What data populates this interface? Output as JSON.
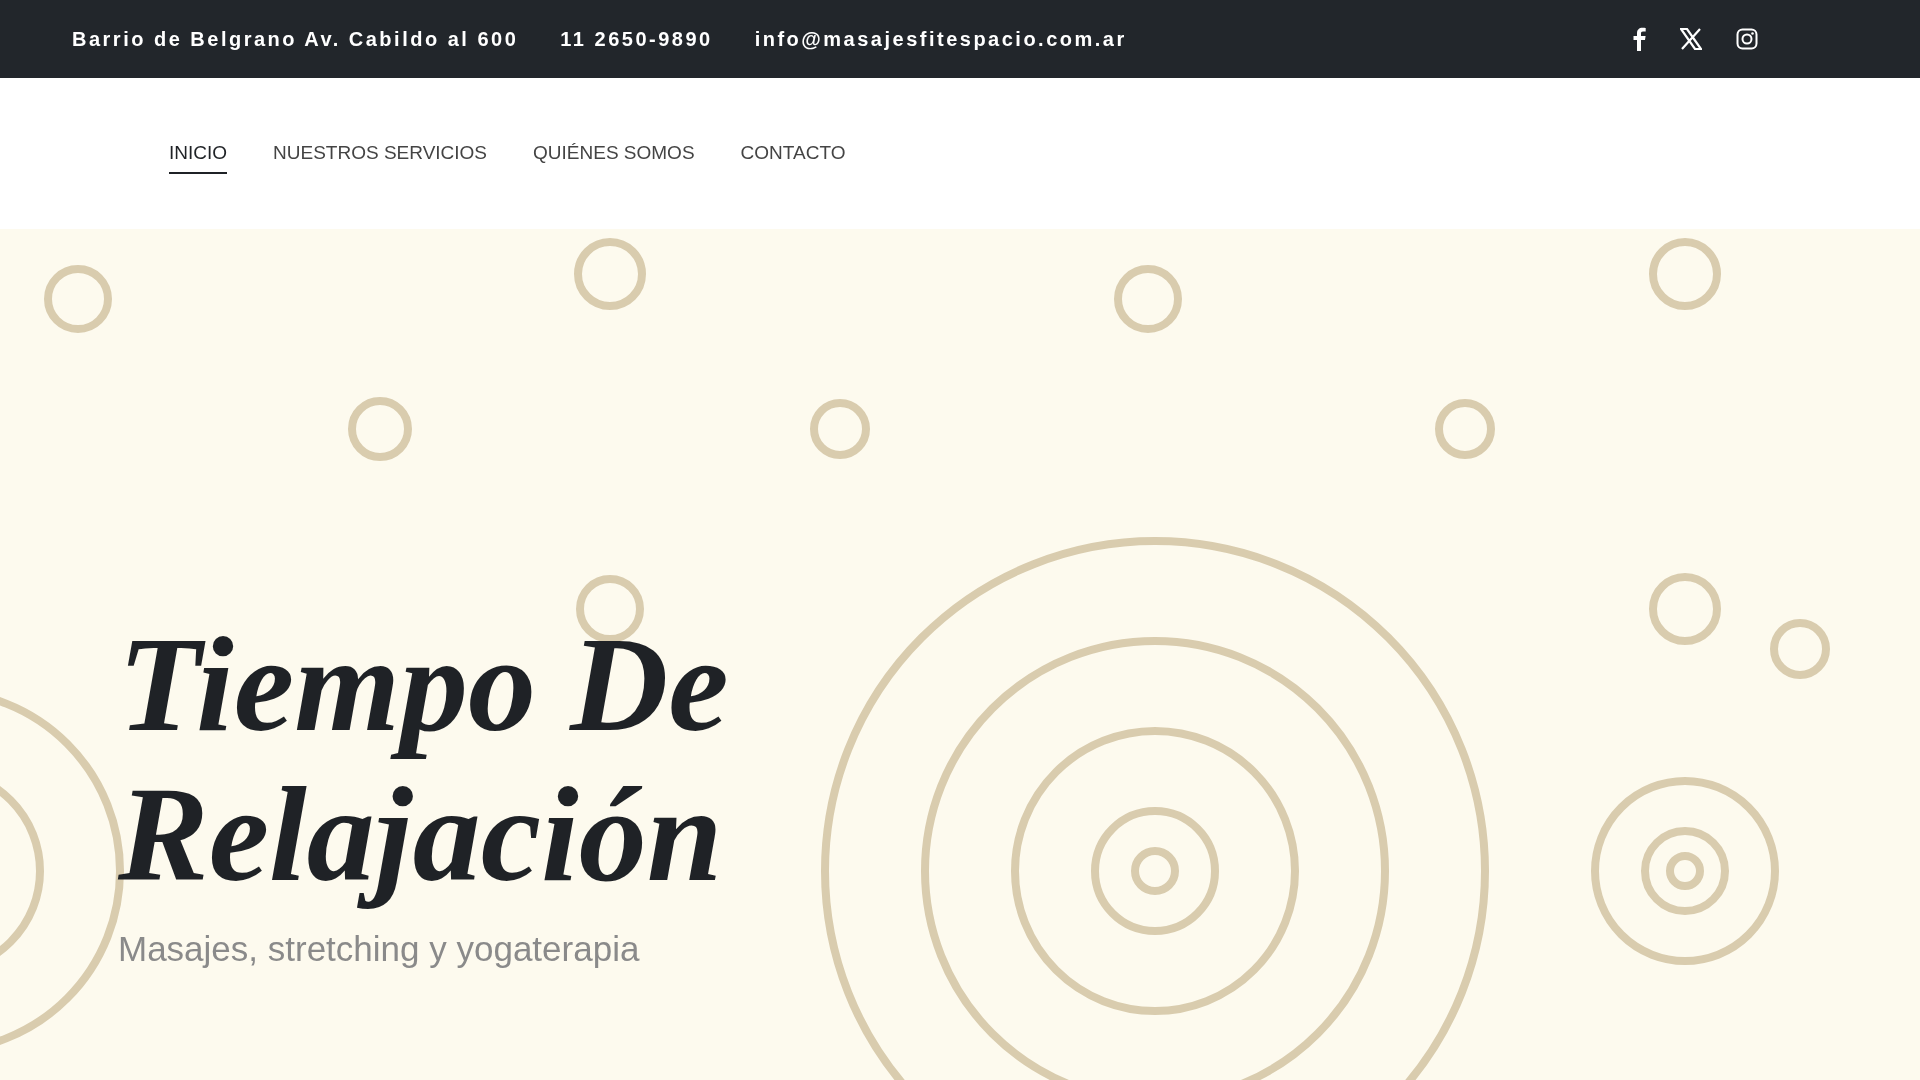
{
  "top_bar": {
    "address": "Barrio de Belgrano Av. Cabildo al 600",
    "phone": "11 2650-9890",
    "email": "info@masajesfitespacio.com.ar"
  },
  "nav": [
    {
      "label": "INICIO",
      "selected": true
    },
    {
      "label": "NUESTROS SERVICIOS",
      "selected": false
    },
    {
      "label": "QUIÉNES SOMOS",
      "selected": false
    },
    {
      "label": "CONTACTO",
      "selected": false
    }
  ],
  "hero": {
    "title": "Tiempo De Relajación",
    "subtitle": "Masajes, stretching y yogaterapia"
  }
}
